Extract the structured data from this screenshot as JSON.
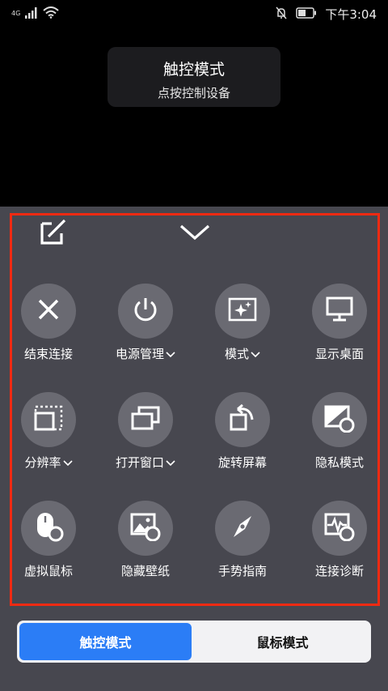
{
  "status_bar": {
    "network": "4G",
    "time": "下午3:04",
    "icons": [
      "signal-icon",
      "wifi-icon",
      "mute-bell-icon",
      "battery-icon"
    ]
  },
  "toast": {
    "title": "触控模式",
    "subtitle": "点按控制设备"
  },
  "panel": {
    "edit_icon": "edit-icon",
    "collapse_icon": "chevron-down-icon",
    "items": [
      {
        "label": "结束连接",
        "icon": "close-icon",
        "has_dropdown": false
      },
      {
        "label": "电源管理",
        "icon": "power-icon",
        "has_dropdown": true
      },
      {
        "label": "模式",
        "icon": "sparkle-icon",
        "has_dropdown": true
      },
      {
        "label": "显示桌面",
        "icon": "monitor-icon",
        "has_dropdown": false
      },
      {
        "label": "分辨率",
        "icon": "resolution-icon",
        "has_dropdown": true
      },
      {
        "label": "打开窗口",
        "icon": "windows-icon",
        "has_dropdown": true
      },
      {
        "label": "旋转屏幕",
        "icon": "rotate-icon",
        "has_dropdown": false
      },
      {
        "label": "隐私模式",
        "icon": "privacy-icon",
        "has_dropdown": false
      },
      {
        "label": "虚拟鼠标",
        "icon": "mouse-icon",
        "has_dropdown": false
      },
      {
        "label": "隐藏壁纸",
        "icon": "wallpaper-icon",
        "has_dropdown": false
      },
      {
        "label": "手势指南",
        "icon": "compass-icon",
        "has_dropdown": false
      },
      {
        "label": "连接诊断",
        "icon": "diagnose-icon",
        "has_dropdown": false
      }
    ]
  },
  "mode_switch": {
    "touch": "触控模式",
    "mouse": "鼠标模式",
    "active": "touch"
  },
  "colors": {
    "panel_bg": "#47474f",
    "button_bg": "#6a6a72",
    "accent": "#2b7df6",
    "highlight": "#f02a12"
  }
}
